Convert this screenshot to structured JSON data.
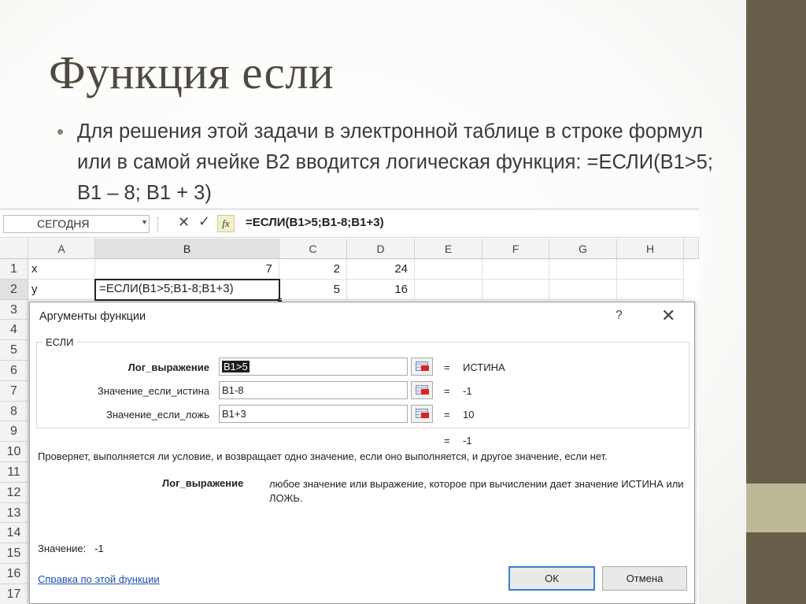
{
  "slide": {
    "title": "Функция если",
    "bullet": "Для решения этой задачи в электронной таблице в строке формул или в самой ячейке B2 вводится логическая функция: =ЕСЛИ(B1>5; B1 – 8; B1 + 3)",
    "colors": {
      "accent_dark": "#675f4c",
      "accent_light": "#bdb998",
      "title": "#4f4a3e"
    }
  },
  "excel": {
    "name_box": "СЕГОДНЯ",
    "cancel_icon": "✕",
    "enter_icon": "✓",
    "fx_label": "fx",
    "formula": "=ЕСЛИ(B1>5;B1-8;B1+3)",
    "columns": [
      "A",
      "B",
      "C",
      "D",
      "E",
      "F",
      "G",
      "H"
    ],
    "rows": [
      "1",
      "2",
      "3",
      "4",
      "5",
      "6",
      "7",
      "8",
      "9",
      "10",
      "11",
      "12",
      "13",
      "14",
      "15",
      "16",
      "17"
    ],
    "cells": {
      "A1": "x",
      "B1": "7",
      "C1": "2",
      "D1": "24",
      "A2": "y",
      "B2": "=ЕСЛИ(B1>5;B1-8;B1+3)",
      "C2": "5",
      "D2": "16"
    }
  },
  "dialog": {
    "title": "Аргументы функции",
    "help": "?",
    "close": "✕",
    "function_name": "ЕСЛИ",
    "args": [
      {
        "label": "Лог_выражение",
        "value": "B1>5",
        "result": "ИСТИНА"
      },
      {
        "label": "Значение_если_истина",
        "value": "B1-8",
        "result": "-1"
      },
      {
        "label": "Значение_если_ложь",
        "value": "B1+3",
        "result": "10"
      }
    ],
    "equals": "=",
    "formula_result": "-1",
    "description": "Проверяет, выполняется ли условие, и возвращает одно значение, если оно выполняется, и другое значение, если нет.",
    "arg_description_name": "Лог_выражение",
    "arg_description_text": "любое значение или выражение, которое при вычислении дает значение ИСТИНА или ЛОЖЬ.",
    "value_label": "Значение:",
    "value": "-1",
    "help_link": "Справка по этой функции",
    "ok": "ОК",
    "cancel": "Отмена"
  }
}
